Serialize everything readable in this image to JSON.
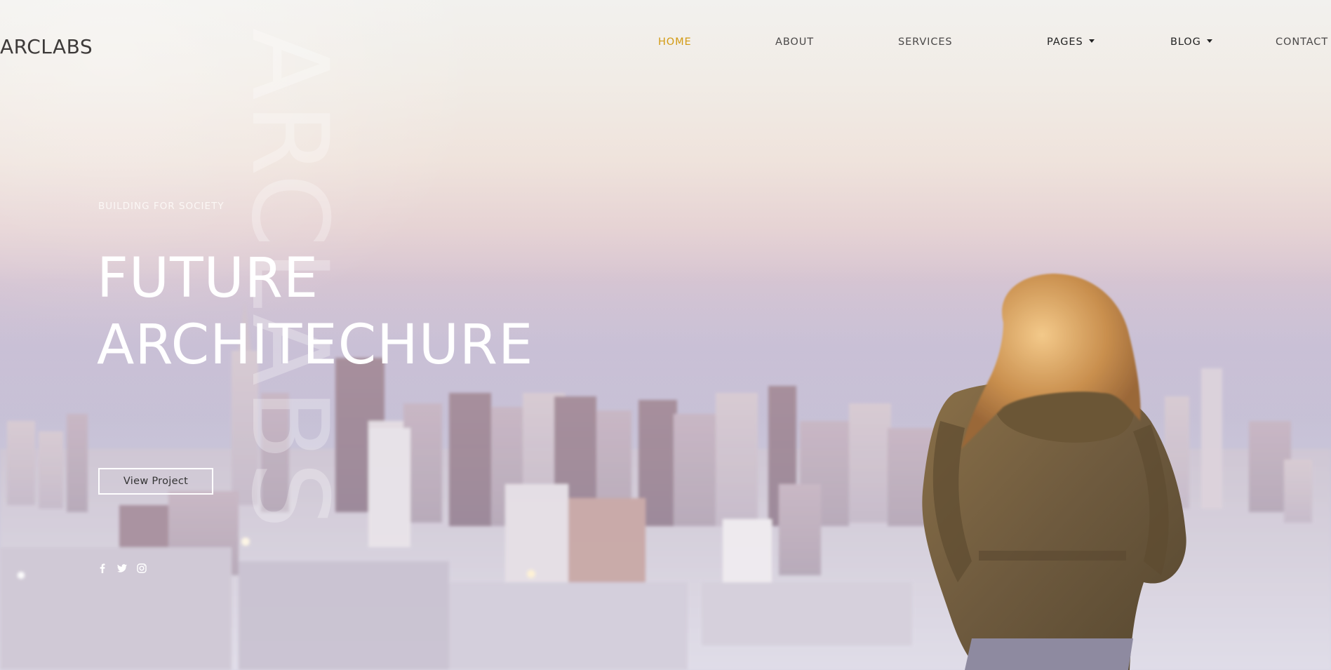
{
  "brand": {
    "logo": "ARCLABS",
    "watermark": "ARCLABS"
  },
  "nav": {
    "items": [
      {
        "label": "HOME",
        "active": true
      },
      {
        "label": "ABOUT"
      },
      {
        "label": "SERVICES"
      },
      {
        "label": "PAGES",
        "dropdown": true
      },
      {
        "label": "BLOG",
        "dropdown": true
      },
      {
        "label": "CONTACT"
      }
    ]
  },
  "hero": {
    "eyebrow": "BUILDING FOR SOCIETY",
    "title_line1": "FUTURE",
    "title_line2": "ARCHITECHURE",
    "cta": "View Project"
  },
  "social": [
    "facebook-icon",
    "twitter-icon",
    "instagram-icon"
  ],
  "colors": {
    "accent": "#d39a12",
    "text_dark": "#3e3b3a",
    "hero_text": "#ffffff"
  }
}
